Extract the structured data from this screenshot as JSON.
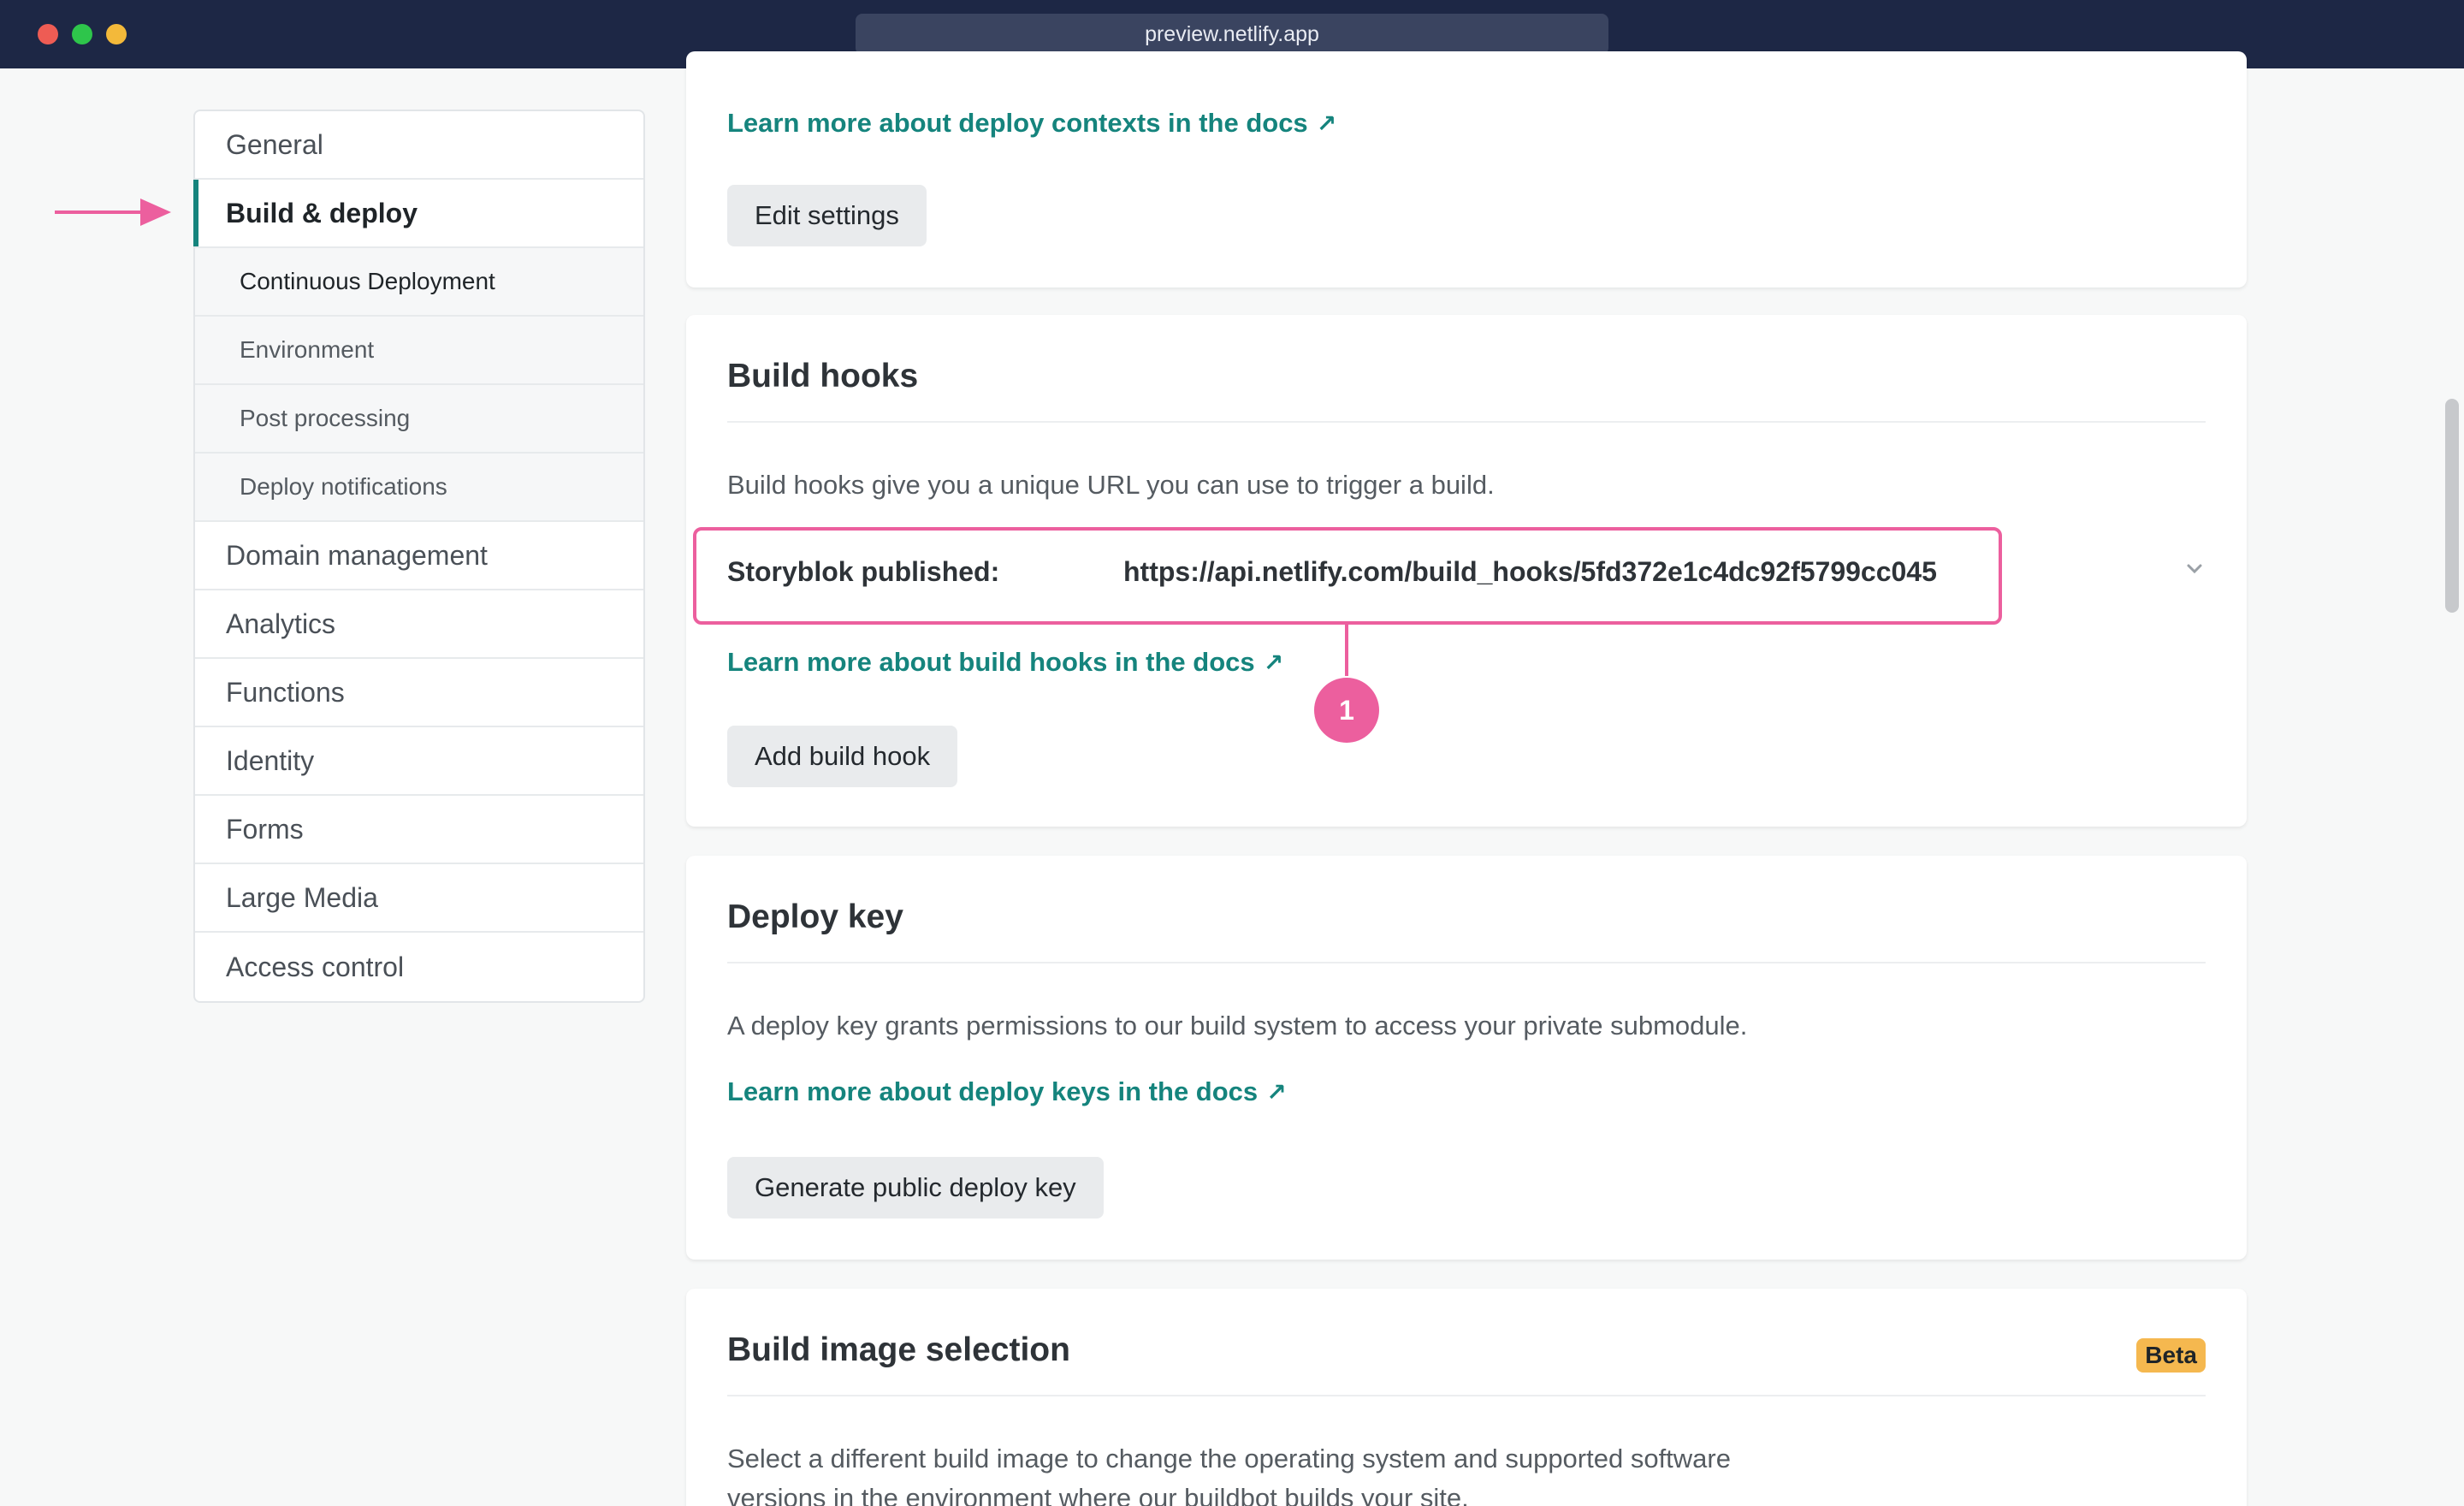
{
  "window": {
    "url": "preview.netlify.app"
  },
  "sidebar": {
    "items": [
      {
        "label": "General"
      },
      {
        "label": "Build & deploy"
      },
      {
        "label": "Continuous Deployment"
      },
      {
        "label": "Environment"
      },
      {
        "label": "Post processing"
      },
      {
        "label": "Deploy notifications"
      },
      {
        "label": "Domain management"
      },
      {
        "label": "Analytics"
      },
      {
        "label": "Functions"
      },
      {
        "label": "Identity"
      },
      {
        "label": "Forms"
      },
      {
        "label": "Large Media"
      },
      {
        "label": "Access control"
      }
    ]
  },
  "deploy_contexts": {
    "docs_link": "Learn more about deploy contexts in the docs",
    "edit_button": "Edit settings"
  },
  "build_hooks": {
    "title": "Build hooks",
    "description": "Build hooks give you a unique URL you can use to trigger a build.",
    "hook": {
      "name": "Storyblok published:",
      "url": "https://api.netlify.com/build_hooks/5fd372e1c4dc92f5799cc045"
    },
    "docs_link": "Learn more about build hooks in the docs",
    "add_button": "Add build hook",
    "callout_number": "1"
  },
  "deploy_key": {
    "title": "Deploy key",
    "description": "A deploy key grants permissions to our build system to access your private submodule.",
    "docs_link": "Learn more about deploy keys in the docs",
    "generate_button": "Generate public deploy key"
  },
  "build_image": {
    "title": "Build image selection",
    "badge": "Beta",
    "description": "Select a different build image to change the operating system and supported software versions in the environment where our buildbot builds your site."
  },
  "colors": {
    "accent": "#15847d",
    "highlight": "#ec5f9e",
    "titlebar": "#1d2745",
    "beta": "#f5b84f"
  },
  "icons": {
    "external_link": "arrow-up-right-icon",
    "chevron": "chevron-down-icon",
    "pointer": "arrow-right-icon"
  }
}
